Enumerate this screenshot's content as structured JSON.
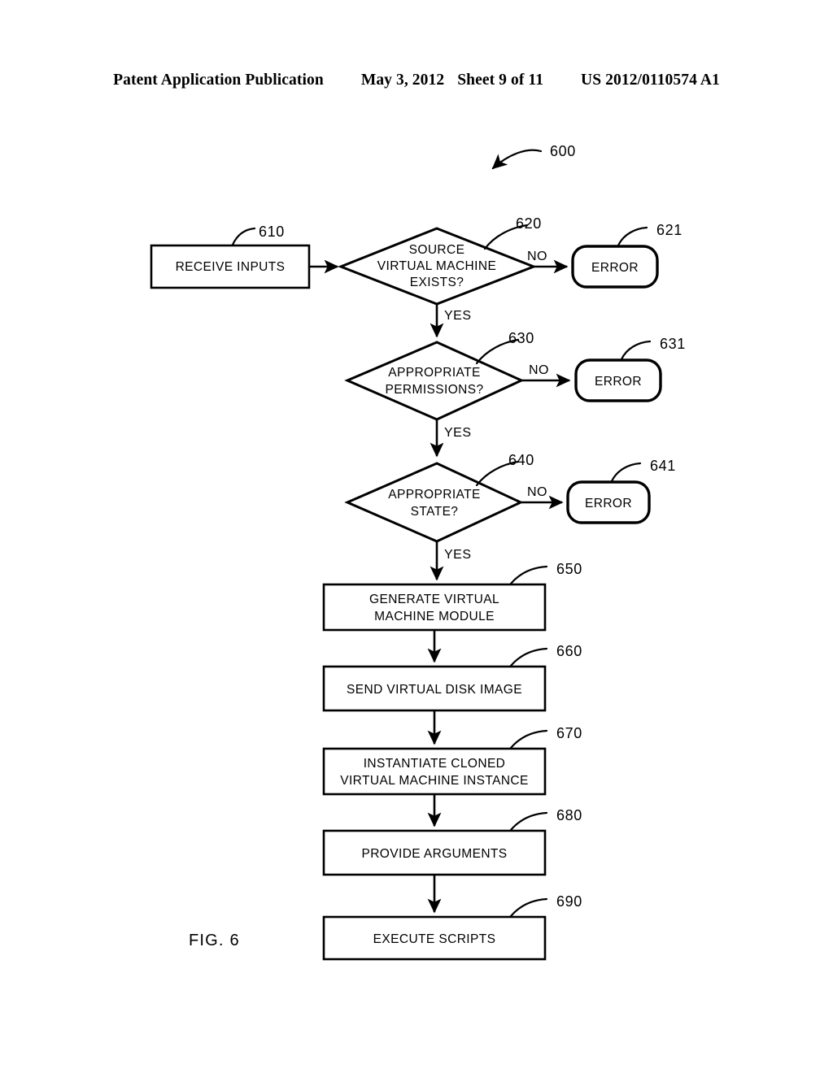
{
  "header": {
    "publication": "Patent Application Publication",
    "date": "May 3, 2012",
    "sheet": "Sheet 9 of 11",
    "number": "US 2012/0110574 A1"
  },
  "figure": {
    "caption": "FIG. 6",
    "diagram_ref": "600",
    "branch_yes": "YES",
    "branch_no": "NO"
  },
  "nodes": {
    "receive_inputs": {
      "label": "RECEIVE INPUTS",
      "ref": "610"
    },
    "source_vm_exists": {
      "label_line1": "SOURCE",
      "label_line2": "VIRTUAL MACHINE",
      "label_line3": "EXISTS?",
      "ref": "620"
    },
    "error_620": {
      "label": "ERROR",
      "ref": "621"
    },
    "appropriate_permissions": {
      "label_line1": "APPROPRIATE",
      "label_line2": "PERMISSIONS?",
      "ref": "630"
    },
    "error_630": {
      "label": "ERROR",
      "ref": "631"
    },
    "appropriate_state": {
      "label_line1": "APPROPRIATE",
      "label_line2": "STATE?",
      "ref": "640"
    },
    "error_640": {
      "label": "ERROR",
      "ref": "641"
    },
    "generate_vm_module": {
      "label_line1": "GENERATE VIRTUAL",
      "label_line2": "MACHINE MODULE",
      "ref": "650"
    },
    "send_disk_image": {
      "label": "SEND VIRTUAL DISK IMAGE",
      "ref": "660"
    },
    "instantiate_clone": {
      "label_line1": "INSTANTIATE CLONED",
      "label_line2": "VIRTUAL MACHINE INSTANCE",
      "ref": "670"
    },
    "provide_arguments": {
      "label": "PROVIDE ARGUMENTS",
      "ref": "680"
    },
    "execute_scripts": {
      "label": "EXECUTE SCRIPTS",
      "ref": "690"
    }
  },
  "branches": {
    "yes_620": "YES",
    "no_620": "NO",
    "yes_630": "YES",
    "no_630": "NO",
    "yes_640": "YES",
    "no_640": "NO"
  },
  "colors": {
    "ink": "#000000",
    "paper": "#ffffff"
  }
}
